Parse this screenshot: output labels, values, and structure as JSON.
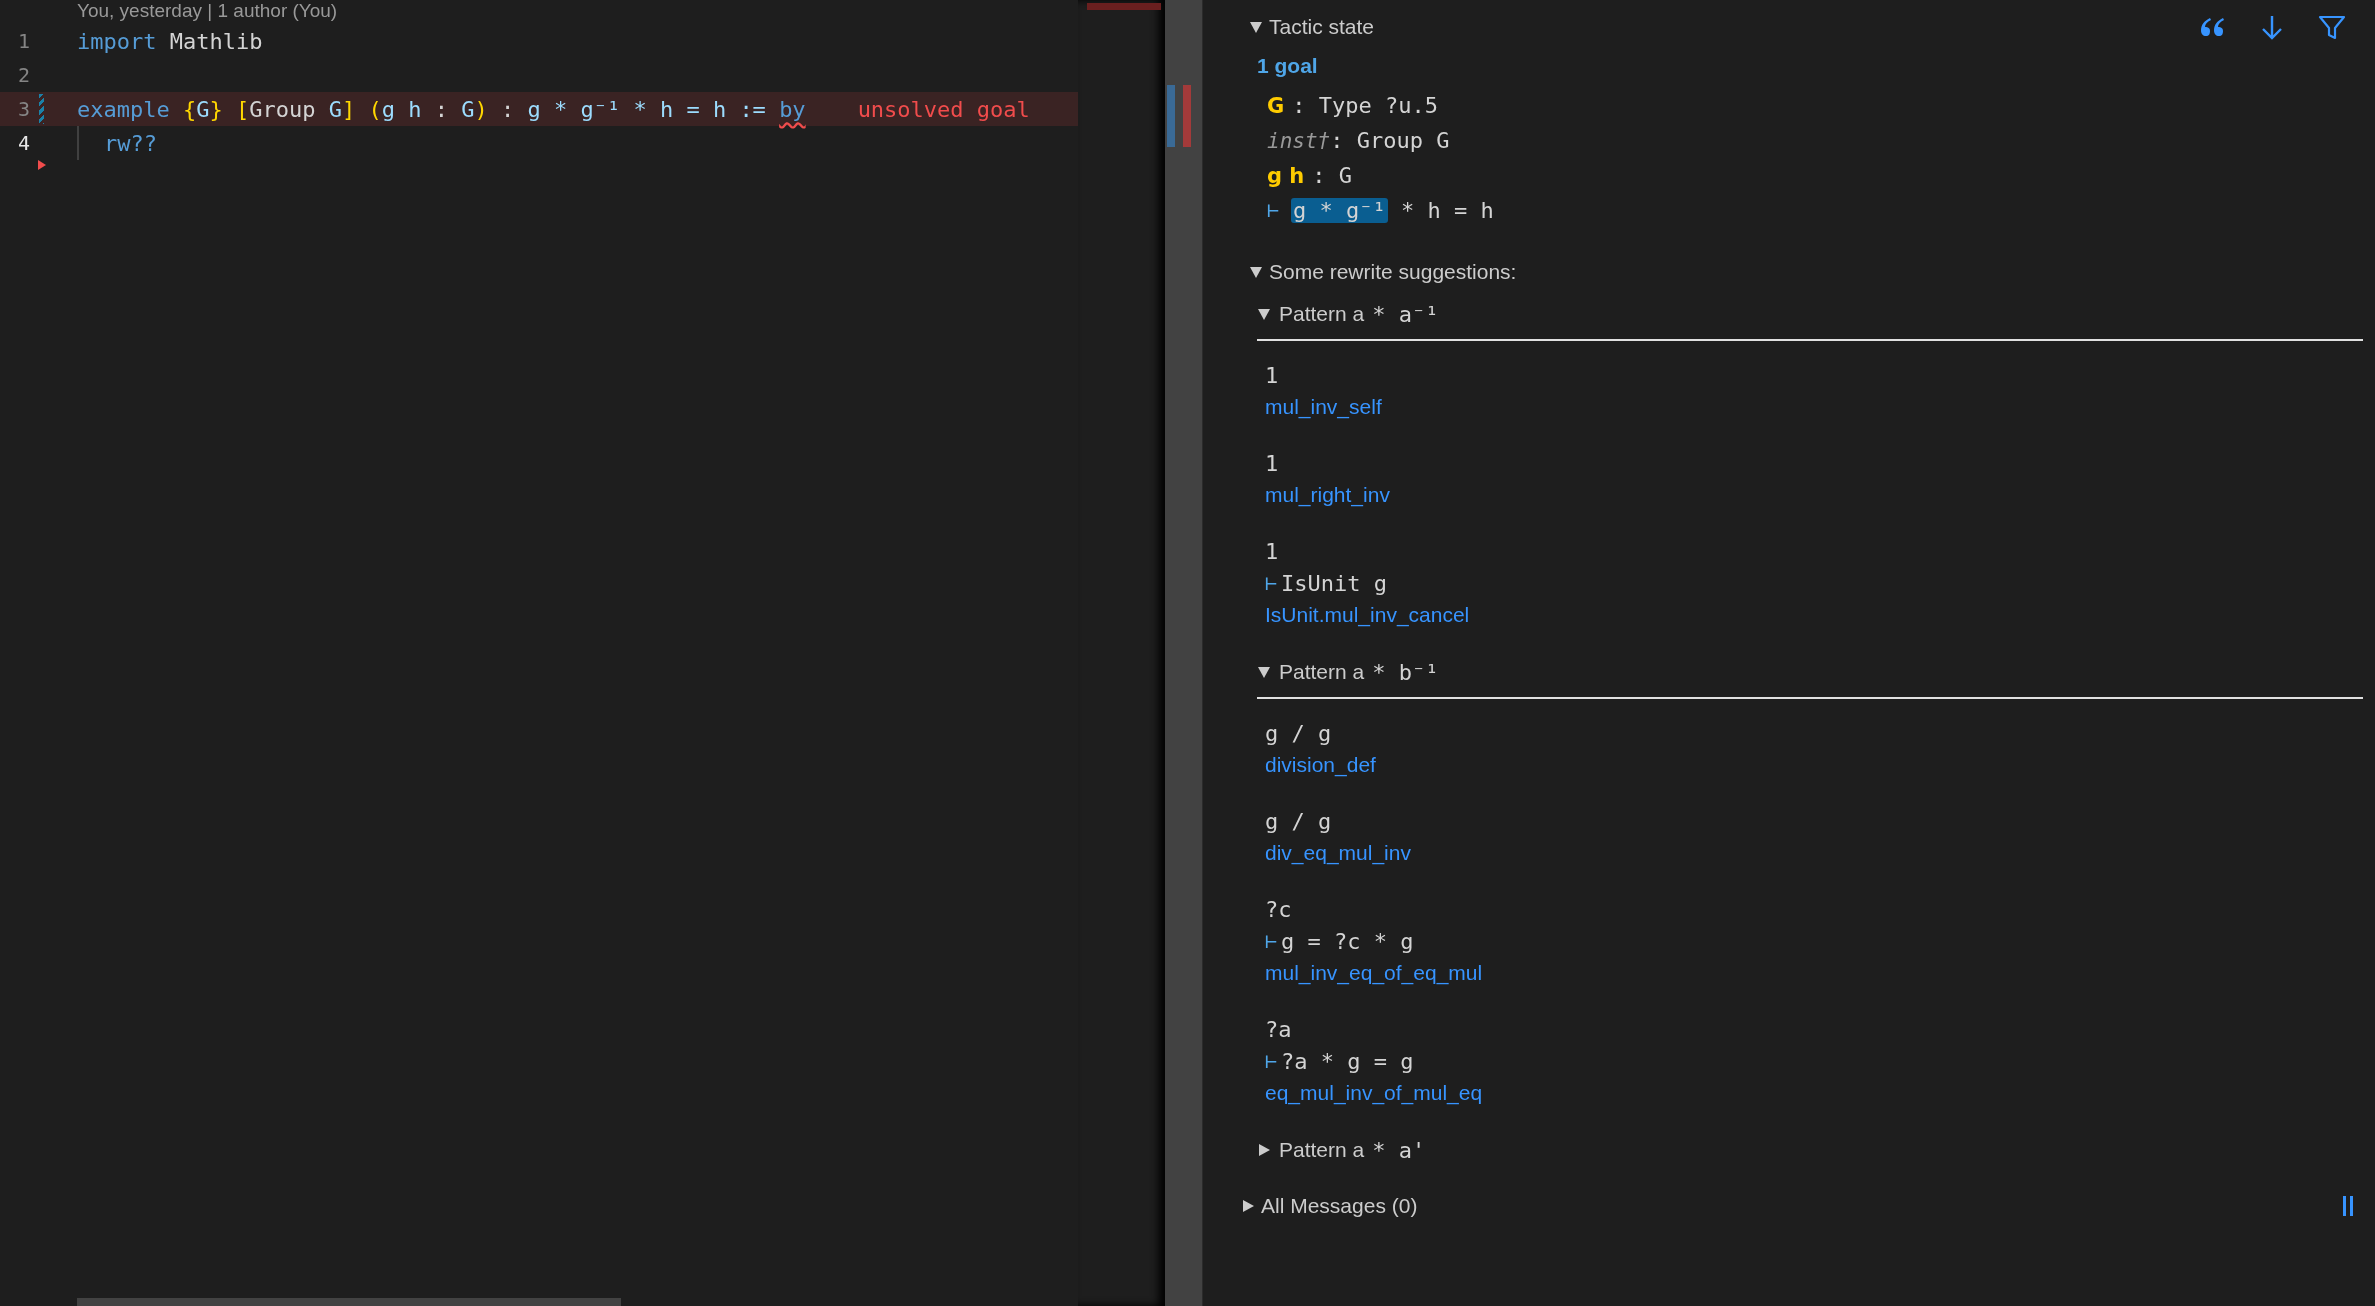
{
  "editor": {
    "codelens": "You, yesterday | 1 author (You)",
    "diagnostic": "unsolved goal",
    "lines": [
      {
        "number": "1",
        "current": false,
        "error": false,
        "tokens": [
          {
            "kind": "keyword",
            "text": "import"
          },
          {
            "kind": "text",
            "text": " Mathlib"
          }
        ]
      },
      {
        "number": "2",
        "current": false,
        "error": false
      },
      {
        "number": "3",
        "current": false,
        "error": true,
        "modified": true,
        "tokens": [
          {
            "kind": "keyword",
            "text": "example "
          },
          {
            "kind": "bracket",
            "text": "{"
          },
          {
            "kind": "ident",
            "text": "G"
          },
          {
            "kind": "bracket",
            "text": "} ["
          },
          {
            "kind": "text",
            "text": "Group "
          },
          {
            "kind": "ident",
            "text": "G"
          },
          {
            "kind": "bracket",
            "text": "] ("
          },
          {
            "kind": "ident",
            "text": "g h"
          },
          {
            "kind": "text",
            "text": " : "
          },
          {
            "kind": "ident",
            "text": "G"
          },
          {
            "kind": "bracket",
            "text": ")"
          },
          {
            "kind": "text",
            "text": " : "
          },
          {
            "kind": "ident",
            "text": "g * g⁻¹ * h = h := "
          },
          {
            "kind": "keyword-error",
            "text": "by"
          }
        ]
      },
      {
        "number": "4",
        "current": true,
        "error": false,
        "indented": true,
        "error_arrow": true,
        "tokens": [
          {
            "kind": "keyword",
            "text": "rw??"
          }
        ]
      }
    ]
  },
  "infoview": {
    "tactic_state": {
      "title": "Tactic state",
      "expanded": true,
      "goal_count": "1 goal",
      "hypotheses": [
        {
          "names": "G",
          "type": ": Type ?u.5",
          "inaccessible": false
        },
        {
          "names": "inst†",
          "type": ": Group G",
          "inaccessible": true
        },
        {
          "names": "g h",
          "type": ": G",
          "inaccessible": false
        }
      ],
      "goal": {
        "turnstile": "⊢",
        "highlighted": "g * g⁻¹",
        "rest": "* h = h"
      }
    },
    "suggestions": {
      "title": "Some rewrite suggestions:",
      "expanded": true,
      "patterns": [
        {
          "label": "Pattern a",
          "expr": "* a⁻¹",
          "expanded": true,
          "rewrites": [
            {
              "result": "1",
              "lemma": "mul_inv_self"
            },
            {
              "result": "1",
              "lemma": "mul_right_inv"
            },
            {
              "result": "1",
              "side_goal": {
                "turnstile": "⊢",
                "expr": "IsUnit g"
              },
              "lemma": "IsUnit.mul_inv_cancel"
            }
          ]
        },
        {
          "label": "Pattern a",
          "expr": "* b⁻¹",
          "expanded": true,
          "rewrites": [
            {
              "result": "g / g",
              "lemma": "division_def"
            },
            {
              "result": "g / g",
              "lemma": "div_eq_mul_inv"
            },
            {
              "result": "?c",
              "side_goal": {
                "turnstile": "⊢",
                "expr": "g = ?c * g"
              },
              "lemma": "mul_inv_eq_of_eq_mul"
            },
            {
              "result": "?a",
              "side_goal": {
                "turnstile": "⊢",
                "expr": "?a * g = g"
              },
              "lemma": "eq_mul_inv_of_mul_eq"
            }
          ]
        },
        {
          "label": "Pattern a",
          "expr": "* a'",
          "expanded": false
        }
      ]
    },
    "messages": {
      "title": "All Messages (0)",
      "expanded": false
    }
  }
}
